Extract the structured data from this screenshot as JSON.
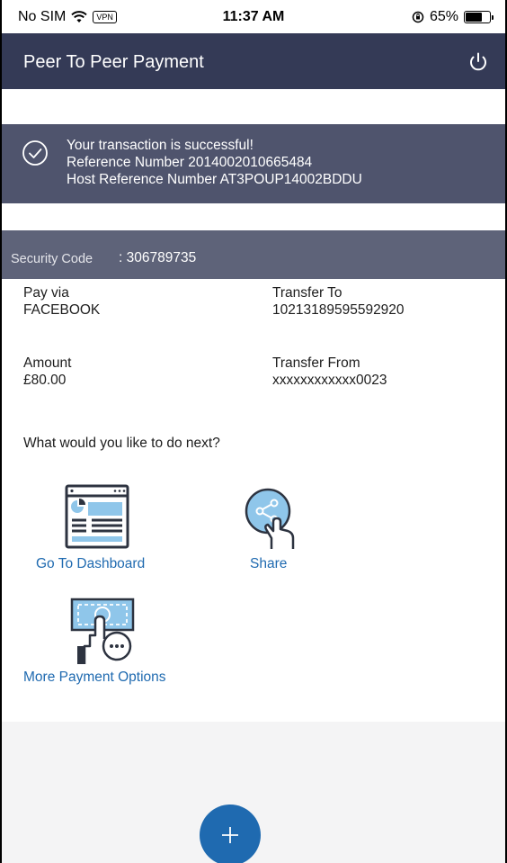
{
  "status_bar": {
    "carrier": "No SIM",
    "vpn": "VPN",
    "time": "11:37 AM",
    "battery": "65%",
    "battery_level": 0.65
  },
  "header": {
    "title": "Peer To Peer Payment",
    "power_icon": "power-icon"
  },
  "banner": {
    "icon": "check-circle-icon",
    "line1": "Your transaction is successful!",
    "line2": "Reference Number 2014002010665484",
    "line3": "Host Reference Number AT3POUP14002BDDU"
  },
  "security": {
    "label": "Security Code",
    "value": ": 306789735"
  },
  "details": {
    "pay_via_label": "Pay via",
    "pay_via_value": "FACEBOOK",
    "transfer_to_label": "Transfer To",
    "transfer_to_value": "10213189595592920",
    "amount_label": "Amount",
    "amount_value": "£80.00",
    "transfer_from_label": "Transfer From",
    "transfer_from_value": "xxxxxxxxxxxx0023"
  },
  "next": {
    "question": "What would you like to do next?",
    "actions": [
      {
        "label": "Go To Dashboard",
        "icon": "dashboard-icon"
      },
      {
        "label": "Share",
        "icon": "share-icon"
      },
      {
        "label": "More Payment Options",
        "icon": "payment-options-icon"
      }
    ]
  },
  "fab": {
    "icon": "plus-icon"
  },
  "colors": {
    "header_bg": "#343a56",
    "banner_bg": "#4f546d",
    "security_bg": "#5e6379",
    "link": "#1f6ab0",
    "fab_bg": "#1f6ab0"
  }
}
